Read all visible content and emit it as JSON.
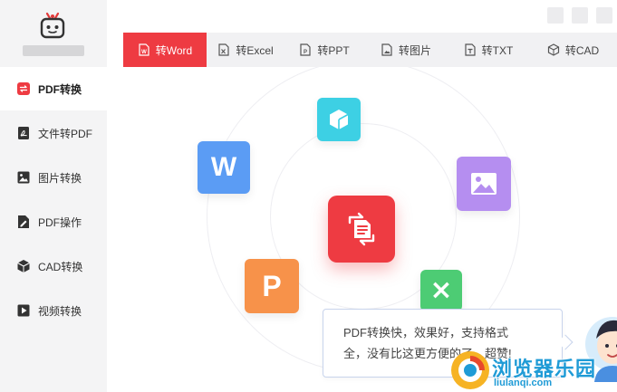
{
  "sidebar": {
    "items": [
      {
        "label": "PDF转换",
        "icon": "swap-icon",
        "active": true
      },
      {
        "label": "文件转PDF",
        "icon": "pdf-file-icon",
        "active": false
      },
      {
        "label": "图片转换",
        "icon": "image-icon",
        "active": false
      },
      {
        "label": "PDF操作",
        "icon": "pdf-edit-icon",
        "active": false
      },
      {
        "label": "CAD转换",
        "icon": "cube-icon",
        "active": false
      },
      {
        "label": "视频转换",
        "icon": "play-icon",
        "active": false
      }
    ]
  },
  "tabs": [
    {
      "label": "转Word",
      "icon": "word-file-icon",
      "active": true
    },
    {
      "label": "转Excel",
      "icon": "excel-file-icon",
      "active": false
    },
    {
      "label": "转PPT",
      "icon": "ppt-file-icon",
      "active": false
    },
    {
      "label": "转图片",
      "icon": "image-file-icon",
      "active": false
    },
    {
      "label": "转TXT",
      "icon": "txt-file-icon",
      "active": false
    },
    {
      "label": "转CAD",
      "icon": "cad-file-icon",
      "active": false
    }
  ],
  "hero": {
    "tile_letters": {
      "word": "W",
      "ppt": "P",
      "excel": "×"
    }
  },
  "bubble": {
    "line1": "PDF转换快，效果好，支持格式",
    "line2": "全，没有比这更方便的了，超赞!"
  },
  "watermark": {
    "title": "浏览器乐园",
    "url": "liulanqi.com"
  },
  "colors": {
    "accent": "#ee3b42",
    "word": "#5b9cf4",
    "ppt": "#f7924a",
    "excel": "#4dcc74",
    "cad": "#3dd0e4",
    "image": "#b58ef0",
    "watermark": "#1f9bd6"
  }
}
